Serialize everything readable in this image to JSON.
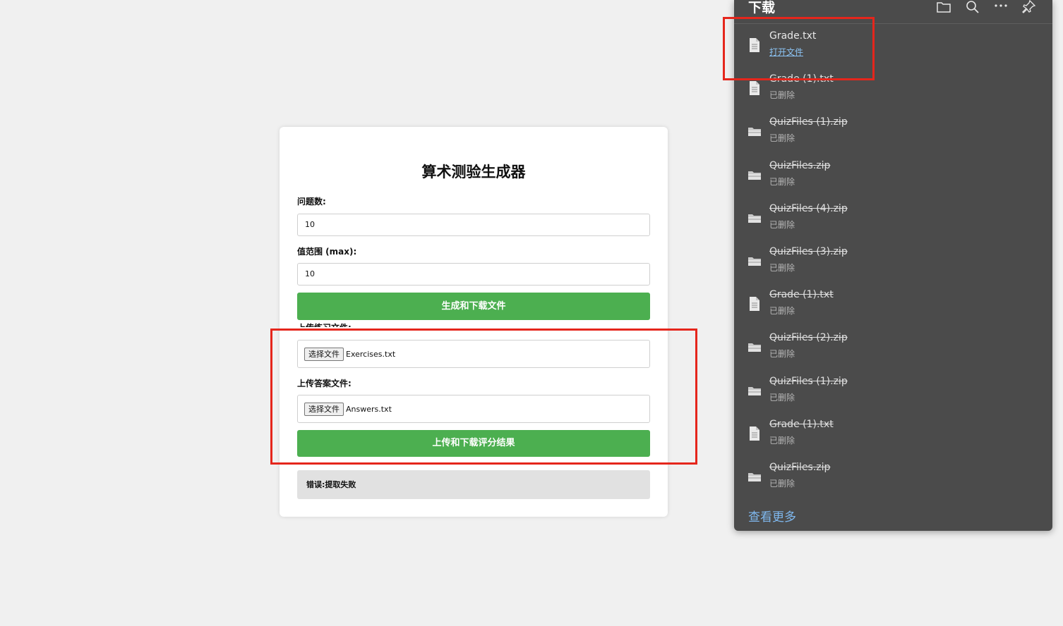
{
  "form": {
    "title": "算术测验生成器",
    "question_count_label": "问题数:",
    "question_count_value": "10",
    "range_label": "值范围 (max):",
    "range_value": "10",
    "generate_button": "生成和下载文件",
    "upload_exercises_label": "上传练习文件:",
    "choose_file_label": "选择文件",
    "exercises_file": "Exercises.txt",
    "upload_answers_label": "上传答案文件:",
    "answers_file": "Answers.txt",
    "grade_button": "上传和下载评分结果",
    "message": "错误:提取失败"
  },
  "colors": {
    "accent_green": "#4caf50",
    "annotation_red": "#e5261c",
    "panel_bg": "#4b4b4b",
    "link_blue": "#7fb8ef"
  },
  "downloads": {
    "title": "下载",
    "icons": [
      "folder-icon",
      "search-icon",
      "more-icon",
      "pin-icon"
    ],
    "items": [
      {
        "name": "Grade.txt",
        "status": "打开文件",
        "type": "txt",
        "deleted": false
      },
      {
        "name": "Grade (1).txt",
        "status": "已删除",
        "type": "txt",
        "deleted": true
      },
      {
        "name": "QuizFiles (1).zip",
        "status": "已删除",
        "type": "zip",
        "deleted": true
      },
      {
        "name": "QuizFiles.zip",
        "status": "已删除",
        "type": "zip",
        "deleted": true
      },
      {
        "name": "QuizFiles (4).zip",
        "status": "已删除",
        "type": "zip",
        "deleted": true
      },
      {
        "name": "QuizFiles (3).zip",
        "status": "已删除",
        "type": "zip",
        "deleted": true
      },
      {
        "name": "Grade (1).txt",
        "status": "已删除",
        "type": "txt",
        "deleted": true
      },
      {
        "name": "QuizFiles (2).zip",
        "status": "已删除",
        "type": "zip",
        "deleted": true
      },
      {
        "name": "QuizFiles (1).zip",
        "status": "已删除",
        "type": "zip",
        "deleted": true
      },
      {
        "name": "Grade (1).txt",
        "status": "已删除",
        "type": "txt",
        "deleted": true
      },
      {
        "name": "QuizFiles.zip",
        "status": "已删除",
        "type": "zip",
        "deleted": true
      }
    ],
    "see_more": "查看更多"
  }
}
